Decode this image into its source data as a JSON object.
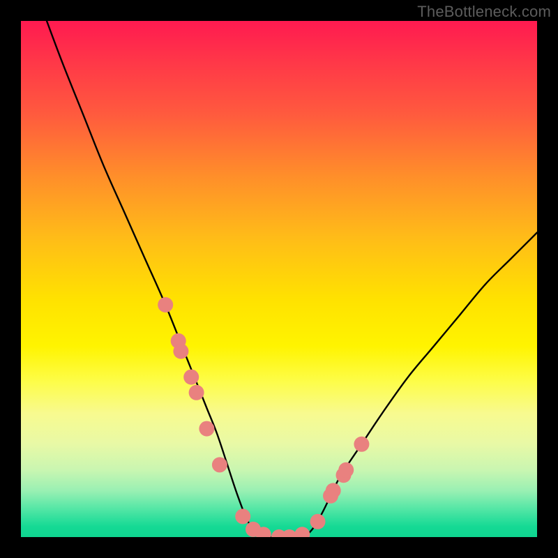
{
  "watermark": "TheBottleneck.com",
  "chart_data": {
    "type": "line",
    "title": "",
    "xlabel": "",
    "ylabel": "",
    "xlim": [
      0,
      100
    ],
    "ylim": [
      0,
      100
    ],
    "grid": false,
    "legend": false,
    "background": "rainbow-vertical-gradient (red top → green bottom) indicating bottleneck severity",
    "curve_note": "V-shaped bottleneck curve: left branch starts near 100% at x≈5, drops to ~0% near x≈45, flat 0% trough x≈45–55, right branch rises to ~60% by x≈100",
    "series": [
      {
        "name": "bottleneck-curve",
        "x": [
          5,
          8,
          12,
          16,
          20,
          24,
          28,
          32,
          34,
          36,
          38,
          40,
          42,
          44,
          46,
          48,
          50,
          52,
          54,
          56,
          58,
          60,
          62,
          66,
          70,
          75,
          80,
          85,
          90,
          95,
          100
        ],
        "values": [
          100,
          92,
          82,
          72,
          63,
          54,
          45,
          35,
          30,
          25,
          20,
          14,
          8,
          3,
          0.5,
          0,
          0,
          0,
          0,
          1,
          4,
          8,
          12,
          18,
          24,
          31,
          37,
          43,
          49,
          54,
          59
        ]
      }
    ],
    "trough_markers": {
      "name": "data-dots",
      "x": [
        28,
        30.5,
        31,
        33,
        34,
        36,
        38.5,
        43,
        45,
        47,
        50,
        52,
        54.5,
        57.5,
        60,
        60.5,
        62.5,
        63,
        66
      ],
      "values": [
        45,
        38,
        36,
        31,
        28,
        21,
        14,
        4,
        1.5,
        0.5,
        0,
        0,
        0.5,
        3,
        8,
        9,
        12,
        13,
        18
      ]
    }
  }
}
